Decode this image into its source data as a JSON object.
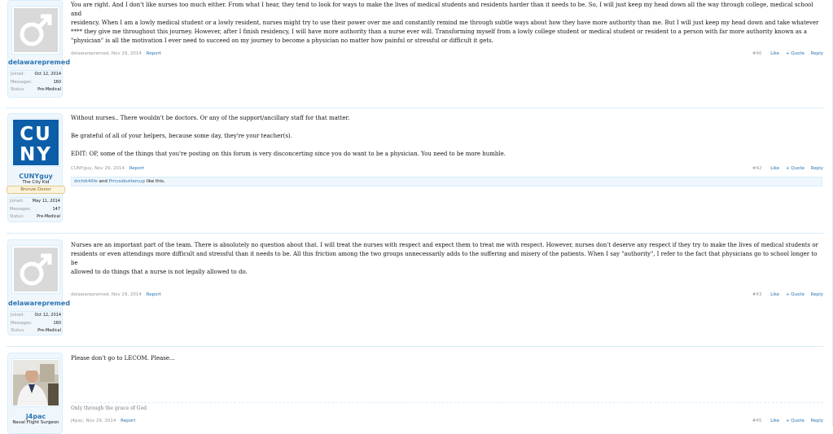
{
  "posts": [
    {
      "user": {
        "name": "delawarepremed",
        "joined_label": "Joined:",
        "joined": "Oct 12, 2014",
        "messages_label": "Messages:",
        "messages": "160",
        "status_label": "Status:",
        "status": "Pre-Medical",
        "avatar_icon": "male-default-avatar-icon"
      },
      "lines": [
        "You are right. And I don't like nurses too much either. From what I hear, they tend to look for ways to make the lives of medical students and residents harder than it needs to be. So, I will just keep my head down all the way through college, medical school and",
        "residency. When I am a lowly medical student or a lowly resident, nurses might try to use their power over me and constantly remind me through subtle ways about how they have more authority than me. But I will just keep my head down and take whatever",
        "**** they give me throughout this journey. However, after I finish residency, I will have more authority than a nurse ever will. Transforming myself from a lowly college student or medical student or resident to a person with far more authority known as a",
        "\"physician\" is all the motivation I ever need to succeed on my journey to become a physician no matter how painful or stressful or difficult it gets."
      ],
      "meta": {
        "author": "delawarepremed",
        "date": "Nov 29, 2014",
        "report": "Report",
        "number": "#40",
        "like": "Like",
        "quote": "+ Quote",
        "reply": "Reply"
      }
    },
    {
      "user": {
        "name": "CUNYguy",
        "title": "The City Kid",
        "badge": "Bronze Donor",
        "joined_label": "Joined:",
        "joined": "May 11, 2014",
        "messages_label": "Messages:",
        "messages": "147",
        "status_label": "Status:",
        "status": "Pre-Medical",
        "avatar_text": "CUNY"
      },
      "paragraphs": [
        "Without nurses.. There wouldn't be doctors. Or any of the support/ancillary staff for that matter.",
        "Be grateful of all of your helpers, because some day, they're your teacher(s).",
        "EDIT: OP, some of the things that you're posting on this forum is very disconcerting since you do want to be a physician. You need to be more humble."
      ],
      "meta": {
        "author": "CUNYguy",
        "date": "Nov 29, 2014",
        "report": "Report",
        "number": "#42",
        "like": "Like",
        "quote": "+ Quote",
        "reply": "Reply"
      },
      "likes": {
        "user1": "drchik4life",
        "and": " and ",
        "user2": "Prncssbuttercup",
        "suffix": " like this."
      }
    },
    {
      "user": {
        "name": "delawarepremed",
        "joined_label": "Joined:",
        "joined": "Oct 12, 2014",
        "messages_label": "Messages:",
        "messages": "160",
        "status_label": "Status:",
        "status": "Pre-Medical",
        "avatar_icon": "male-default-avatar-icon"
      },
      "lines": [
        "Nurses are an important part of the team. There is absolutely no question about that. I will treat the nurses with respect and expect them to treat me with respect. However, nurses don't deserve any respect if they try to make the lives of medical students or",
        "residents or even attendings more difficult and stressful than it needs to be. All this friction among the two groups unnecessarily adds to the suffering and misery of the patients. When I say \"authority\", I refer to the fact that physicians go to school longer to be",
        "allowed to do things that a nurse is not legally allowed to do."
      ],
      "meta": {
        "author": "delawarepremed",
        "date": "Nov 29, 2014",
        "report": "Report",
        "number": "#43",
        "like": "Like",
        "quote": "+ Quote",
        "reply": "Reply"
      }
    },
    {
      "user": {
        "name": "j4pac",
        "title": "Naval Flight Surgeon"
      },
      "text": "Please don't go to LECOM. Please...",
      "signature": "Only through the grace of God",
      "meta": {
        "author": "j4pac",
        "date": "Nov 29, 2014",
        "report": "Report",
        "number": "#45",
        "like": "Like",
        "quote": "+ Quote",
        "reply": "Reply"
      }
    }
  ],
  "colors": {
    "link": "#2b74b1",
    "muted": "#969696",
    "panel": "#f0f7fc",
    "border": "#d7edfc",
    "cuny_blue": "#0c5ea8"
  }
}
